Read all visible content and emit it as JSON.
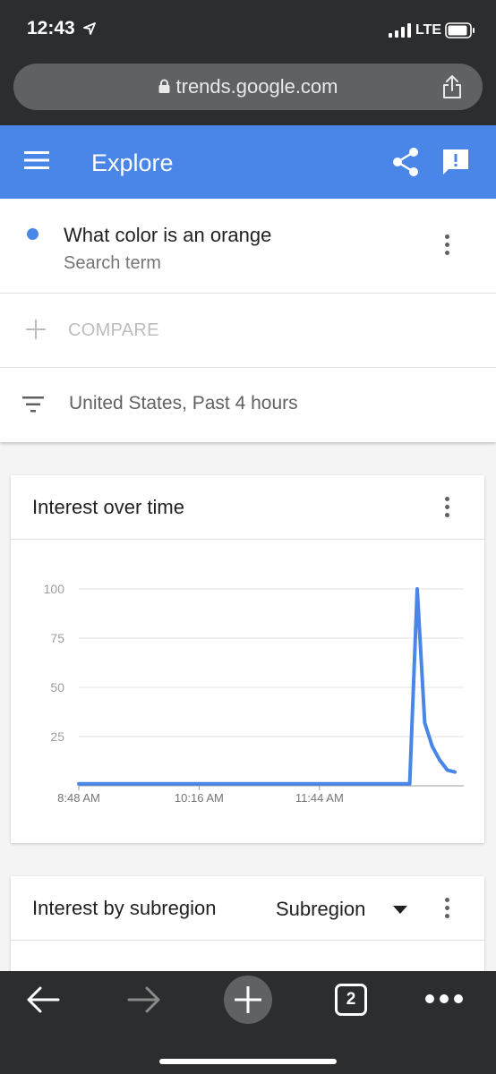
{
  "status_bar": {
    "time": "12:43",
    "network": "LTE"
  },
  "browser": {
    "url": "trends.google.com",
    "tab_count": "2"
  },
  "header": {
    "title": "Explore"
  },
  "search_term": {
    "title": "What color is an orange",
    "subtitle": "Search term",
    "color": "#4a86e8"
  },
  "compare": {
    "label": "COMPARE"
  },
  "filter": {
    "label": "United States, Past 4 hours"
  },
  "interest_card": {
    "title": "Interest over time"
  },
  "chart_data": {
    "type": "line",
    "x_ticks": [
      "8:48 AM",
      "10:16 AM",
      "11:44 AM"
    ],
    "y_ticks": [
      25,
      50,
      75,
      100
    ],
    "ylim": [
      0,
      100
    ],
    "series": [
      {
        "color": "#4a86e8",
        "values": [
          1,
          1,
          1,
          1,
          1,
          1,
          1,
          1,
          1,
          1,
          1,
          1,
          1,
          1,
          1,
          1,
          1,
          1,
          1,
          1,
          1,
          1,
          1,
          1,
          1,
          1,
          1,
          1,
          1,
          1,
          1,
          1,
          1,
          1,
          1,
          1,
          1,
          1,
          1,
          1,
          1,
          1,
          1,
          1,
          1,
          100,
          32,
          20,
          13,
          8,
          7
        ]
      }
    ],
    "grid": true
  },
  "subregion_card": {
    "title": "Interest by subregion",
    "dropdown_value": "Subregion"
  }
}
